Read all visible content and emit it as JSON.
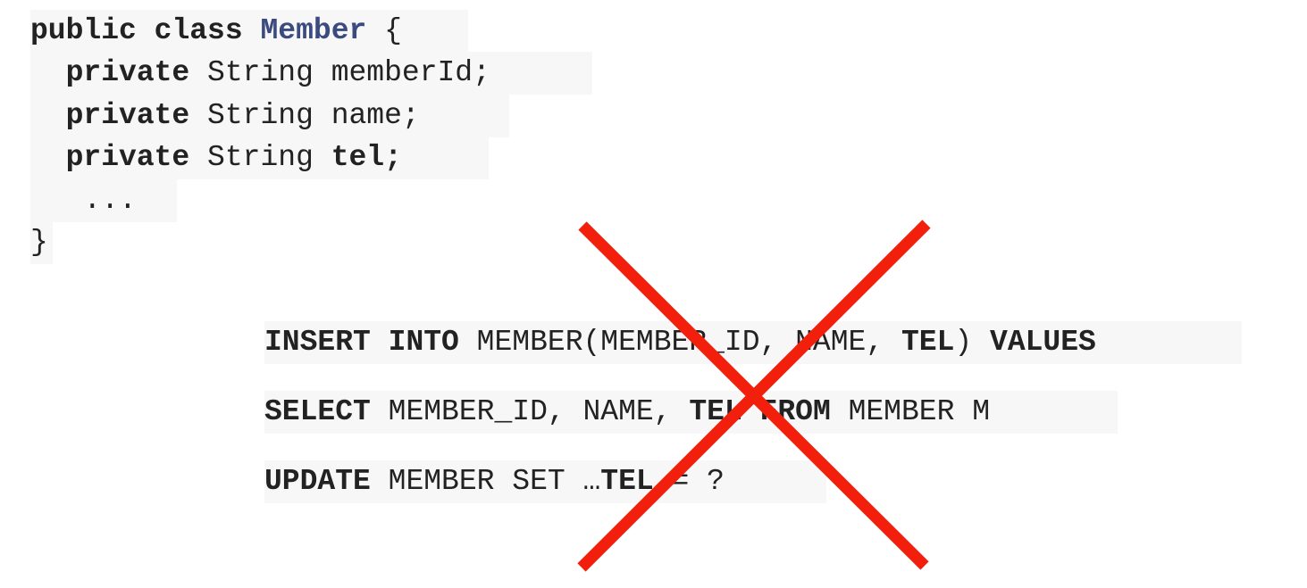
{
  "java_class": {
    "line1": {
      "kw_public": "public",
      "kw_class": "class",
      "class_name": "Member",
      "brace_open": "{"
    },
    "fields": [
      {
        "modifier": "private",
        "type": "String",
        "name": "memberId;"
      },
      {
        "modifier": "private",
        "type": "String",
        "name": "name;"
      },
      {
        "modifier": "private",
        "type": "String",
        "name": "tel;"
      }
    ],
    "ellipsis": "...",
    "brace_close": "}"
  },
  "sql": {
    "insert": {
      "kw1": "INSERT",
      "kw2": "INTO",
      "table_open": "MEMBER(MEMBER_ID, NAME,",
      "col_tel": "TEL",
      "close": ")",
      "kw3": "VALUES"
    },
    "select": {
      "kw1": "SELECT",
      "cols": "MEMBER_ID, NAME,",
      "col_tel": "TEL",
      "kw2": "FROM",
      "rest": "MEMBER M"
    },
    "update": {
      "kw1": "UPDATE",
      "middle": "MEMBER SET …",
      "col_tel": "TEL",
      "rest": "= ?"
    }
  },
  "colors": {
    "class_name": "#3b4a80",
    "code_text": "#222222",
    "code_background": "#f7f7f7",
    "cross": "#f21f0c"
  },
  "icons": {
    "cross": "x-cross-mark"
  }
}
